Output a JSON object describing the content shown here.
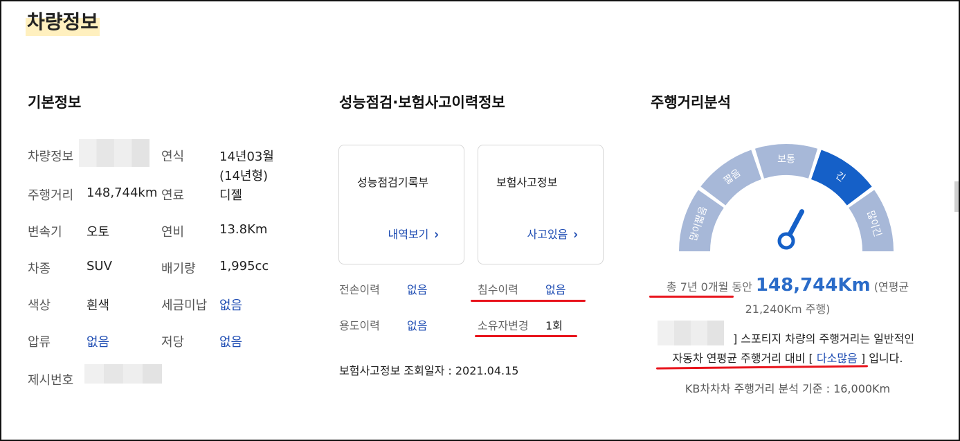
{
  "page_title": "차량정보",
  "basic": {
    "title": "기본정보",
    "rows": [
      {
        "l1": "차량정보",
        "v1": "",
        "l2": "연식",
        "v2a": "14년03월",
        "v2b": "(14년형)"
      },
      {
        "l1": "주행거리",
        "v1": "148,744km",
        "l2": "연료",
        "v2a": "디젤"
      },
      {
        "l1": "변속기",
        "v1": "오토",
        "l2": "연비",
        "v2a": "13.8Km"
      },
      {
        "l1": "차종",
        "v1": "SUV",
        "l2": "배기량",
        "v2a": "1,995cc"
      },
      {
        "l1": "색상",
        "v1": "흰색",
        "l2": "세금미납",
        "v2a": "없음"
      },
      {
        "l1": "압류",
        "v1": "없음",
        "l2": "저당",
        "v2a": "없음"
      },
      {
        "l1": "제시번호",
        "v1": ""
      }
    ]
  },
  "inspection": {
    "title": "성능점검·보험사고이력정보",
    "cards": [
      {
        "title": "성능점검기록부",
        "link": "내역보기"
      },
      {
        "title": "보험사고정보",
        "link": "사고있음"
      }
    ],
    "history": [
      {
        "label": "전손이력",
        "value": "없음"
      },
      {
        "label": "침수이력",
        "value": "없음"
      },
      {
        "label": "용도이력",
        "value": "없음"
      },
      {
        "label": "소유자변경",
        "value": "1회"
      }
    ],
    "inquiry": "보험사고정보 조회일자 : 2021.04.15"
  },
  "mileage": {
    "title": "주행거리분석",
    "gauge_labels": [
      "많이짧음",
      "짧음",
      "보통",
      "긴",
      "많이긴"
    ],
    "active_index": 3,
    "colors": {
      "segment": "#a7b8d8",
      "active": "#1560c8",
      "needle": "#1560c8"
    },
    "summary_prefix": "총 7년 0개월 동안",
    "summary_value": "148,744Km",
    "summary_suffix": "(연평균",
    "summary_annual": "21,240Km 주행)",
    "desc_part1": "] 스포티지 차량의 주행거리는 일반적인",
    "desc_part2": "자동차 연평균 주행거리 대비 [",
    "desc_highlight": "다소많음",
    "desc_part3": "] 입니다.",
    "basis": "KB차차차 주행거리 분석 기준 : 16,000Km"
  }
}
